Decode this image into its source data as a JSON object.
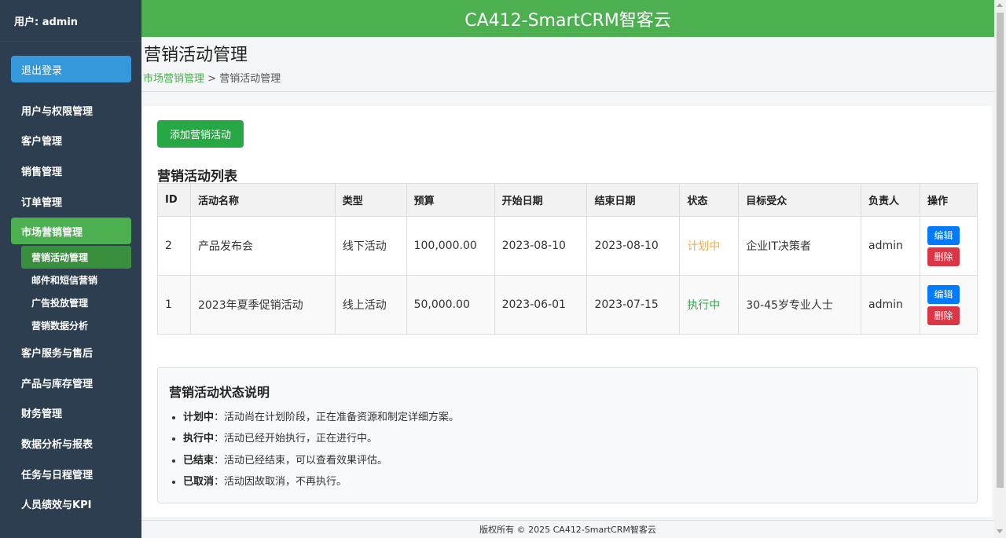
{
  "sidebar": {
    "user_label": "用户: admin",
    "logout_label": "退出登录",
    "items": [
      {
        "label": "用户与权限管理"
      },
      {
        "label": "客户管理"
      },
      {
        "label": "销售管理"
      },
      {
        "label": "订单管理"
      },
      {
        "label": "市场营销管理"
      },
      {
        "label": "客户服务与售后"
      },
      {
        "label": "产品与库存管理"
      },
      {
        "label": "财务管理"
      },
      {
        "label": "数据分析与报表"
      },
      {
        "label": "任务与日程管理"
      },
      {
        "label": "人员绩效与KPI"
      }
    ],
    "subitems": [
      {
        "label": "营销活动管理"
      },
      {
        "label": "邮件和短信营销"
      },
      {
        "label": "广告投放管理"
      },
      {
        "label": "营销数据分析"
      }
    ]
  },
  "header": {
    "title": "CA412-SmartCRM智客云"
  },
  "page": {
    "title": "营销活动管理",
    "breadcrumb_parent": "市场营销管理",
    "breadcrumb_sep": " > ",
    "breadcrumb_current": "营销活动管理"
  },
  "toolbar": {
    "add_label": "添加营销活动"
  },
  "table": {
    "title": "营销活动列表",
    "columns": [
      "ID",
      "活动名称",
      "类型",
      "预算",
      "开始日期",
      "结束日期",
      "状态",
      "目标受众",
      "负责人",
      "操作"
    ],
    "rows": [
      {
        "id": "2",
        "name": "产品发布会",
        "type": "线下活动",
        "budget": "100,000.00",
        "start": "2023-08-10",
        "end": "2023-08-10",
        "status": "计划中",
        "audience": "企业IT决策者",
        "owner": "admin",
        "edit": "编辑",
        "delete": "删除"
      },
      {
        "id": "1",
        "name": "2023年夏季促销活动",
        "type": "线上活动",
        "budget": "50,000.00",
        "start": "2023-06-01",
        "end": "2023-07-15",
        "status": "执行中",
        "audience": "30-45岁专业人士",
        "owner": "admin",
        "edit": "编辑",
        "delete": "删除"
      }
    ]
  },
  "legend": {
    "title": "营销活动状态说明",
    "items": [
      {
        "term": "计划中",
        "desc": "：活动尚在计划阶段，正在准备资源和制定详细方案。"
      },
      {
        "term": "执行中",
        "desc": "：活动已经开始执行，正在进行中。"
      },
      {
        "term": "已结束",
        "desc": "：活动已经结束，可以查看效果评估。"
      },
      {
        "term": "已取消",
        "desc": "：活动因故取消，不再执行。"
      }
    ]
  },
  "footer": {
    "text": "版权所有 © 2025 CA412-SmartCRM智客云"
  },
  "colors": {
    "brand": "#4caf50",
    "sidebar": "#2c3e50",
    "logout": "#3498db",
    "add": "#28a745",
    "edit": "#007bff",
    "delete": "#dc3545",
    "status_plan": "#f0ad4e",
    "status_run": "#28a745"
  }
}
